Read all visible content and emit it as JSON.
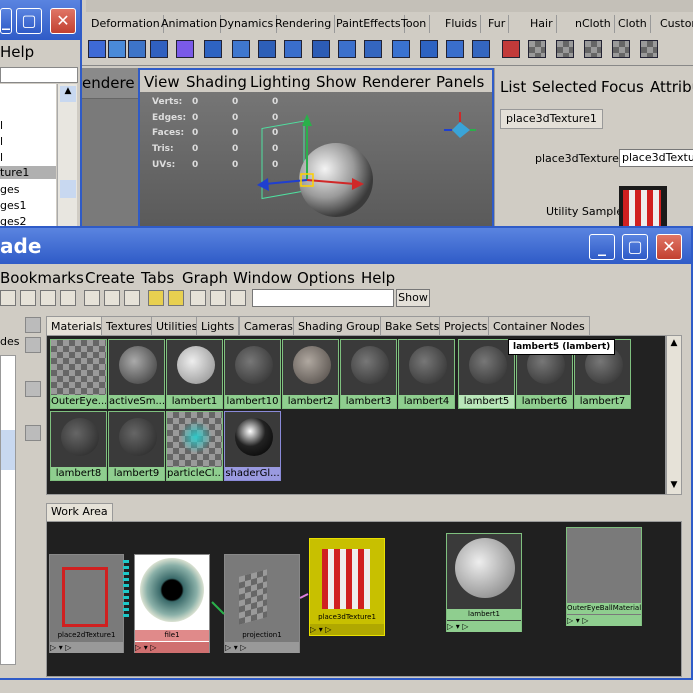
{
  "top_left_window": {
    "help_menu": "Help",
    "outliner_items": [
      "l",
      "l",
      "l",
      "ture1",
      "ges",
      "ges1",
      "ges2"
    ]
  },
  "maya_menu_tabs": [
    "Deformation",
    "Animation",
    "Dynamics",
    "Rendering",
    "PaintEffects",
    "Toon",
    "Fluids",
    "Fur",
    "Hair",
    "nCloth",
    "Cloth",
    "Custon"
  ],
  "viewport": {
    "partial_label": "endere",
    "menu": [
      "View",
      "Shading",
      "Lighting",
      "Show",
      "Renderer",
      "Panels"
    ],
    "hud_labels": [
      "Verts:",
      "Edges:",
      "Faces:",
      "Tris:",
      "UVs:"
    ],
    "hud_values": [
      [
        "0",
        "0",
        "0"
      ],
      [
        "0",
        "0",
        "0"
      ],
      [
        "0",
        "0",
        "0"
      ],
      [
        "0",
        "0",
        "0"
      ],
      [
        "0",
        "0",
        "0"
      ]
    ]
  },
  "attr_editor": {
    "menu": [
      "List",
      "Selected",
      "Focus",
      "Attribu"
    ],
    "tab": "place3dTexture1",
    "field_label": "place3dTexture:",
    "field_value": "place3dTextur",
    "sample_label": "Utility Sample"
  },
  "hypershade": {
    "title": "ade",
    "menu": [
      "Bookmarks",
      "Create",
      "Tabs",
      "Graph",
      "Window",
      "Options",
      "Help"
    ],
    "show_button": "Show",
    "left_label": "des",
    "tabs": [
      "Materials",
      "Textures",
      "Utilities",
      "Lights",
      "Cameras",
      "Shading Groups",
      "Bake Sets",
      "Projects",
      "Container Nodes"
    ],
    "tooltip": "lambert5 (lambert)",
    "materials_row1": [
      "OuterEye...",
      "activeSm...",
      "lambert1",
      "lambert10",
      "lambert2",
      "lambert3",
      "lambert4",
      "lambert5",
      "lambert6",
      "lambert7"
    ],
    "materials_row2": [
      "lambert8",
      "lambert9",
      "particleCl...",
      "shaderGl..."
    ],
    "work_area_tab": "Work Area",
    "nodes": [
      "place2dTexture1",
      "file1",
      "projection1",
      "place3dTexture1",
      "lambert1",
      "OuterEyeBallMaterial"
    ]
  },
  "colors": {
    "accent": "#2f5bc7",
    "material_label": "#8fce8f",
    "selected_material": "#b9e6b9",
    "work_bg": "#202020"
  }
}
